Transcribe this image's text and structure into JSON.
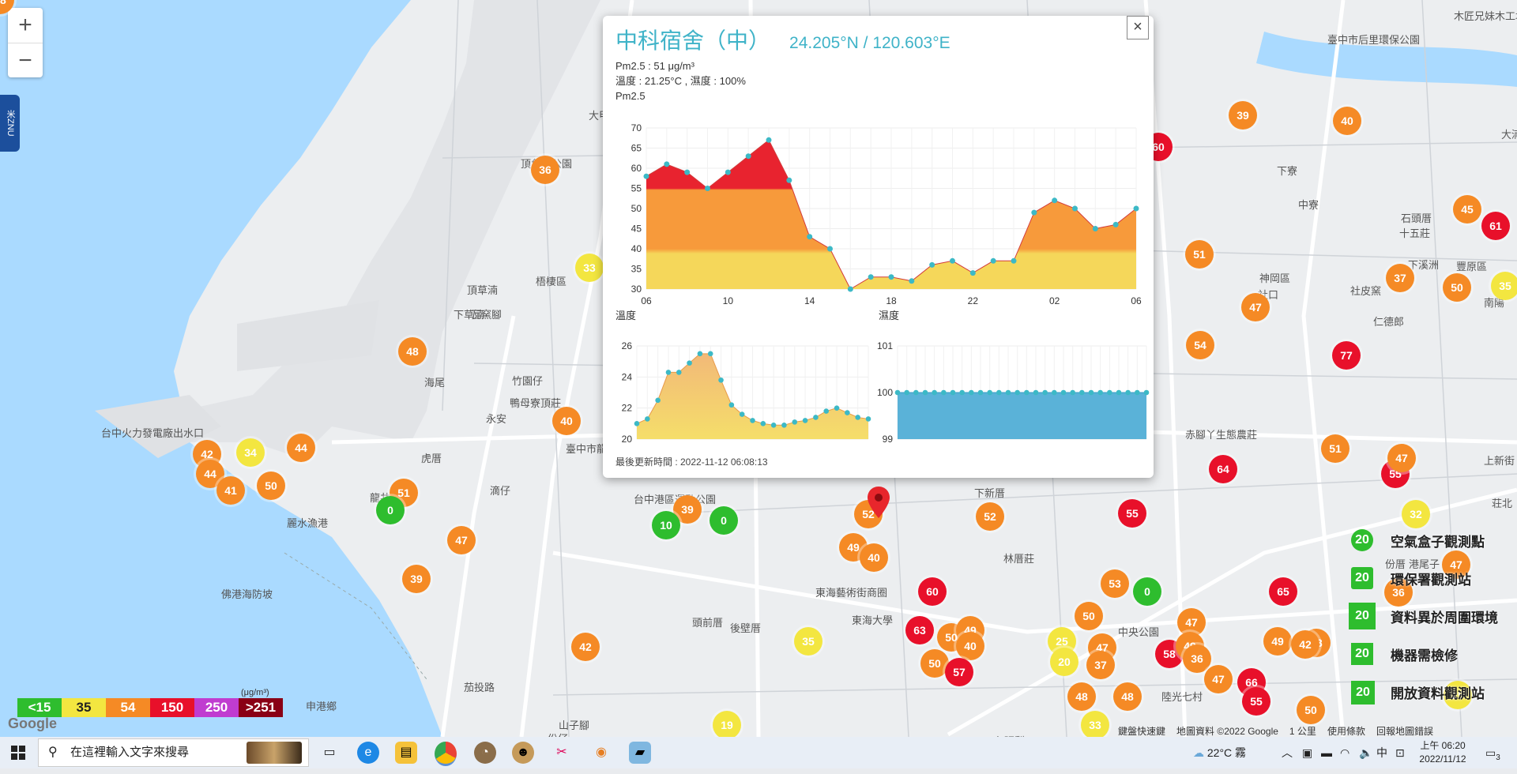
{
  "zoom": {
    "in_label": "+",
    "out_label": "−"
  },
  "side_tab": {
    "label": "米ZNU"
  },
  "map_labels": [
    "台中火力發電廠出水口",
    "龍井",
    "海尾",
    "梧棲區",
    "頂草湳",
    "下草湳",
    "瓦窯腳",
    "竹園仔",
    "鴨母寮頂莊",
    "永安",
    "虎厝",
    "滴仔",
    "麗水漁港",
    "佛港海防坡",
    "申港鄉",
    "茄投路",
    "頭前厝",
    "東海藝術街商圈",
    "東海大學",
    "後壁厝",
    "林厝莊",
    "下新厝",
    "中央公園",
    "陸光七村",
    "神岡區",
    "社口",
    "仁德郎",
    "豐原區",
    "南陽",
    "下溪洲",
    "山子腳",
    "份仔",
    "下七張犁",
    "大甲",
    "大湳",
    "頂魚寮公園",
    "臺中市龍井區龍海國民小學",
    "台中港區運動公園",
    "下寮",
    "中寮",
    "石頭厝",
    "十五莊",
    "社皮窯",
    "赤腳丫生態農莊",
    "上新街",
    "荘北",
    "份厝",
    "港尾子",
    "臺中市后里環保公園",
    "木匠兄妹木工坊"
  ],
  "markers": [
    "36",
    "33",
    "48",
    "40",
    "42",
    "34",
    "44",
    "44",
    "41",
    "50",
    "51",
    "0",
    "47",
    "39",
    "42",
    "39",
    "10",
    "0",
    "52",
    "49",
    "40",
    "60",
    "63",
    "50",
    "49",
    "40",
    "50",
    "57",
    "35",
    "19",
    "52",
    "55",
    "53",
    "0",
    "50",
    "25",
    "20",
    "47",
    "37",
    "48",
    "48",
    "33",
    "47",
    "58",
    "49",
    "36",
    "47",
    "66",
    "55",
    "50",
    "49",
    "43",
    "65",
    "42",
    "39",
    "40",
    "60",
    "51",
    "54",
    "47",
    "37",
    "50",
    "45",
    "61",
    "77",
    "64",
    "51",
    "55",
    "47",
    "32",
    "36",
    "47",
    "25",
    "35",
    "48"
  ],
  "popup": {
    "close_label": "×",
    "station_name": "中科宿舍（中）",
    "coordinates": "24.205°N / 120.603°E",
    "pm25_line": "Pm2.5 : 51 μg/m³",
    "weather_line": "溫度 : 21.25°C , 濕度 : 100%",
    "pm25_title": "Pm2.5",
    "temp_title": "溫度",
    "humidity_title": "濕度",
    "updated": "最後更新時間 : 2022-11-12 06:08:13"
  },
  "chart_data": [
    {
      "type": "area",
      "title": "Pm2.5",
      "x_ticks": [
        "06",
        "10",
        "14",
        "18",
        "22",
        "02",
        "06"
      ],
      "ylim": [
        30,
        70
      ],
      "y_ticks": [
        30,
        35,
        40,
        45,
        50,
        55,
        60,
        65,
        70
      ],
      "values": [
        58,
        61,
        59,
        55,
        59,
        63,
        67,
        57,
        43,
        40,
        30,
        33,
        33,
        32,
        36,
        37,
        34,
        37,
        37,
        49,
        52,
        50,
        45,
        46,
        50
      ],
      "colors": {
        "low": "#f5d75a",
        "mid": "#f79a3b",
        "high": "#e8232f"
      }
    },
    {
      "type": "area",
      "title": "溫度",
      "ylim": [
        20,
        26
      ],
      "y_ticks": [
        20,
        22,
        24,
        26
      ],
      "values": [
        21.0,
        21.3,
        22.5,
        24.3,
        24.3,
        24.9,
        25.5,
        25.5,
        23.8,
        22.2,
        21.6,
        21.2,
        21.0,
        20.9,
        20.9,
        21.1,
        21.2,
        21.4,
        21.8,
        22.0,
        21.7,
        21.4,
        21.3
      ],
      "color": "#f2b978"
    },
    {
      "type": "area",
      "title": "濕度",
      "ylim": [
        99,
        101
      ],
      "y_ticks": [
        99,
        100,
        101
      ],
      "values": [
        100,
        100,
        100,
        100,
        100,
        100,
        100,
        100,
        100,
        100,
        100,
        100,
        100,
        100,
        100,
        100,
        100,
        100,
        100,
        100,
        100,
        100,
        100,
        100,
        100,
        100,
        100,
        100
      ],
      "color": "#5ab2d8"
    }
  ],
  "legend": {
    "items": [
      "<15",
      "35",
      "54",
      "150",
      "250",
      ">251"
    ],
    "unit": "(μg/m³)",
    "colors": [
      "#2ebd2e",
      "#f3e640",
      "#f58a25",
      "#e8102a",
      "#c03cd0",
      "#8a0015"
    ]
  },
  "google_logo": "Google",
  "attribution": [
    "鍵盤快速鍵",
    "地圖資料 ©2022 Google",
    "1 公里",
    "使用條款",
    "回報地圖錯誤"
  ],
  "map_legend": [
    {
      "icon_value": "20",
      "label": "空氣盒子觀測點"
    },
    {
      "icon_value": "20",
      "label": "環保署觀測站"
    },
    {
      "icon_value": "20",
      "label": "資料異於周圍環境"
    },
    {
      "icon_value": "20",
      "label": "機器需檢修"
    },
    {
      "icon_value": "20",
      "label": "開放資料觀測站"
    }
  ],
  "taskbar": {
    "search_placeholder": "在這裡輸入文字來搜尋",
    "weather": "22°C 霧",
    "ime": "中",
    "time": "上午 06:20",
    "date": "2022/11/12",
    "notification_count": "3"
  }
}
